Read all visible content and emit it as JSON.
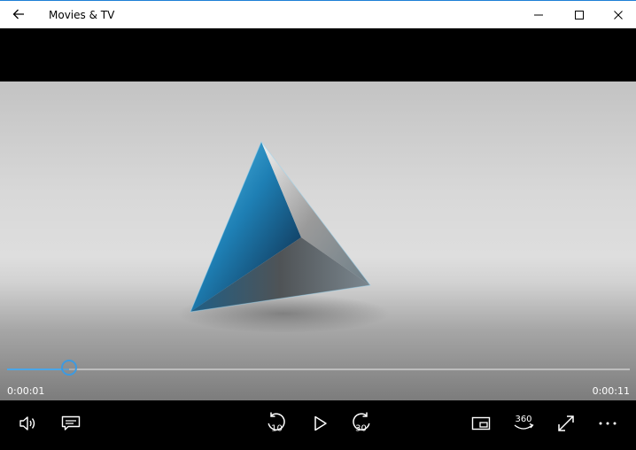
{
  "window": {
    "title": "Movies & TV",
    "back_icon": "back-arrow-icon",
    "minimize_icon": "minimize-icon",
    "maximize_icon": "maximize-icon",
    "close_icon": "close-icon"
  },
  "player": {
    "current_time": "0:00:01",
    "total_time": "0:00:11",
    "progress": 0.1,
    "accent_color": "#3d9ae0",
    "skip_back_seconds": "10",
    "skip_forward_seconds": "30",
    "vr_label": "360"
  },
  "controls": {
    "volume_icon": "volume-icon",
    "captions_icon": "captions-icon",
    "skip_back_icon": "skip-back-10-icon",
    "play_icon": "play-icon",
    "skip_forward_icon": "skip-forward-30-icon",
    "mini_view_icon": "mini-view-icon",
    "vr_icon": "360-video-icon",
    "fullscreen_icon": "fullscreen-icon",
    "more_icon": "more-options-icon"
  }
}
